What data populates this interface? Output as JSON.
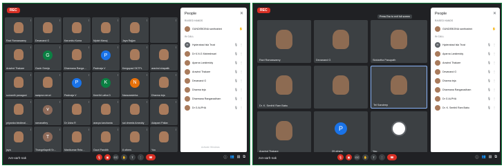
{
  "left": {
    "rec": "REC",
    "tiles": [
      {
        "name": "Ravi Ramaswamy",
        "av": "",
        "color": ""
      },
      {
        "name": "Devanand G",
        "av": "",
        "color": ""
      },
      {
        "name": "Karumbu Kuma",
        "av": "",
        "color": ""
      },
      {
        "name": "Mylah Manoj",
        "av": "",
        "color": ""
      },
      {
        "name": "Jaya Rajjan",
        "av": "",
        "color": ""
      },
      {
        "name": "",
        "av": "",
        "color": ""
      },
      {
        "name": "Aravind Thakare",
        "av": "",
        "color": ""
      },
      {
        "name": "Gavin Sreeja",
        "av": "G",
        "color": "#0b8043"
      },
      {
        "name": "Dharmana Ranga…",
        "av": "",
        "color": ""
      },
      {
        "name": "Padmaja V",
        "av": "P",
        "color": "#1a73e8"
      },
      {
        "name": "Kengupad SKTPL",
        "av": "",
        "color": ""
      },
      {
        "name": "aravind shapalik",
        "av": "",
        "color": ""
      },
      {
        "name": "sumanth panagani",
        "av": "",
        "color": ""
      },
      {
        "name": "swapna neruri",
        "av": "",
        "color": ""
      },
      {
        "name": "Padmaja V",
        "av": "P",
        "color": "#1a73e8"
      },
      {
        "name": "Keerthi Latha D",
        "av": "K",
        "color": "#0b8043"
      },
      {
        "name": "Naravarsimha",
        "av": "N",
        "color": "#e8710a"
      },
      {
        "name": "Dharma teja",
        "av": "",
        "color": ""
      },
      {
        "name": "priyanka bindimal…",
        "av": "",
        "color": ""
      },
      {
        "name": "ramanathry",
        "av": "v",
        "color": "#8e6b5a"
      },
      {
        "name": "Dr Usha R",
        "av": "",
        "color": ""
      },
      {
        "name": "aravya karuhanta",
        "av": "",
        "color": ""
      },
      {
        "name": "sai dmeela Ameddy",
        "av": "",
        "color": ""
      },
      {
        "name": "Adapani Pallav",
        "av": "",
        "color": ""
      },
      {
        "name": "jaya",
        "av": "",
        "color": ""
      },
      {
        "name": "Thangellapelli Sr…",
        "av": "T",
        "color": "#8e6b5a"
      },
      {
        "name": "Manikumar Rela…",
        "av": "",
        "color": ""
      },
      {
        "name": "Gauri Pandith",
        "av": "",
        "color": ""
      },
      {
        "name": "8 others",
        "av": "",
        "color": ""
      },
      {
        "name": "You",
        "av": "",
        "color": ""
      }
    ],
    "people": {
      "title": "People",
      "raised": "RAISED HANDS",
      "raised_name": "GUNDEBOINA santhoshini",
      "in_call": "IN CALL",
      "rows": [
        {
          "name": "Hyderabad Isla Trust",
          "av": "H",
          "color": "#5f6368"
        },
        {
          "name": "Dr K.N.G Maheshwari",
          "av": "",
          "color": "#a97b5c"
        },
        {
          "name": "Aparna Lankireddy",
          "av": "",
          "color": "#a97b5c"
        },
        {
          "name": "Aravind Thakare",
          "av": "",
          "color": "#a97b5c"
        },
        {
          "name": "Devanand G",
          "av": "",
          "color": "#a97b5c"
        },
        {
          "name": "Dharma teja",
          "av": "",
          "color": "#a97b5c"
        },
        {
          "name": "Dharmana Ranganadham",
          "av": "",
          "color": "#a97b5c"
        },
        {
          "name": "Dr G ALPHA",
          "av": "",
          "color": "#a97b5c"
        }
      ],
      "watermark": "Activate Windows"
    },
    "meeting": "zvn-xarh-nak"
  },
  "right": {
    "rec": "REC",
    "tooltip": "Press  Esc  to exit full screen",
    "tiles": [
      {
        "name": "Ravi Ramaswamy"
      },
      {
        "name": "Devanand G"
      },
      {
        "name": "Siddartha Pasupath"
      },
      {
        "name": "Dr. K. Senthil Ram Babu"
      },
      {
        "name": ""
      },
      {
        "name": "Tel Sandeep"
      },
      {
        "name": "Aravind Thakare"
      },
      {
        "name": "29 others"
      },
      {
        "name": "You"
      }
    ],
    "others_av": "P",
    "people": {
      "title": "People",
      "raised": "RAISED HANDS",
      "raised_name": "GUNDEBOINA santhoshini",
      "in_call": "IN CALL",
      "rows": [
        {
          "name": "Hyderabad Isla Trust",
          "av": "H",
          "color": "#5f6368"
        },
        {
          "name": "Aparna Lankireddy",
          "av": "",
          "color": "#a97b5c"
        },
        {
          "name": "Aravind Thakare",
          "av": "",
          "color": "#a97b5c"
        },
        {
          "name": "Devanand G",
          "av": "",
          "color": "#a97b5c"
        },
        {
          "name": "Dharma teja",
          "av": "",
          "color": "#a97b5c"
        },
        {
          "name": "Dharmana Ranganadham",
          "av": "",
          "color": "#a97b5c"
        },
        {
          "name": "Dr G ALPHA",
          "av": "",
          "color": "#a97b5c"
        },
        {
          "name": "Dr. K. Senthil Ram Babu",
          "av": "",
          "color": "#a97b5c"
        }
      ]
    },
    "meeting": "zvn-xarh-nak"
  },
  "colors": {
    "frame_border": "#0f7a3a",
    "end_call": "#d93025",
    "bg": "#202124"
  }
}
